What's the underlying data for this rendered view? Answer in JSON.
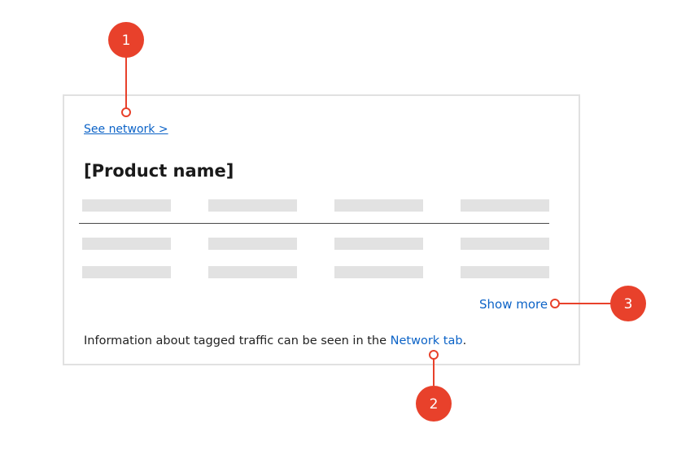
{
  "card": {
    "breadcrumb_link": "See network >",
    "product_name": "[Product name]",
    "show_more_label": "Show more",
    "info_text_before": "Information about tagged traffic can be seen in the ",
    "info_link": "Network tab",
    "info_text_after": "."
  },
  "callouts": {
    "badge_1": "1",
    "badge_2": "2",
    "badge_3": "3",
    "color": "#e8412b"
  },
  "colors": {
    "link": "#0c63c7",
    "skeleton": "#e2e2e2",
    "card_border": "#e1e1e1",
    "divider": "#4a4a4a"
  }
}
